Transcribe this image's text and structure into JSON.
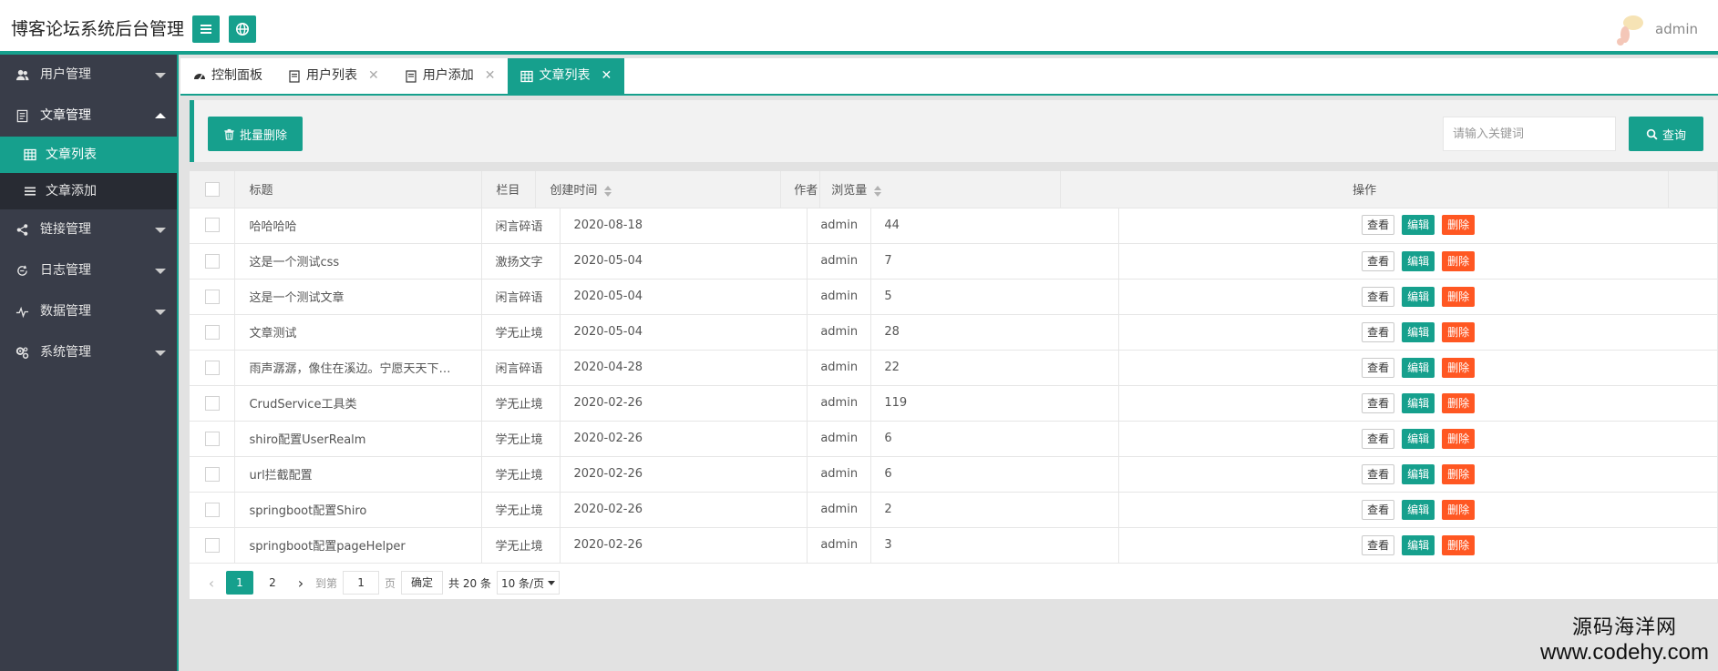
{
  "header": {
    "title": "博客论坛系统后台管理",
    "user_name": "admin"
  },
  "sidebar": {
    "items": [
      {
        "label": "用户管理",
        "icon": "users-icon"
      },
      {
        "label": "文章管理",
        "icon": "document-icon",
        "open": true
      },
      {
        "label": "链接管理",
        "icon": "share-icon"
      },
      {
        "label": "日志管理",
        "icon": "log-icon"
      },
      {
        "label": "数据管理",
        "icon": "pulse-icon"
      },
      {
        "label": "系统管理",
        "icon": "gears-icon"
      }
    ],
    "submenu": [
      {
        "label": "文章列表",
        "icon": "table-icon",
        "active": true
      },
      {
        "label": "文章添加",
        "icon": "list-icon"
      }
    ]
  },
  "tabs": [
    {
      "label": "控制面板",
      "icon": "dashboard-icon",
      "closable": false
    },
    {
      "label": "用户列表",
      "icon": "file-icon",
      "closable": true
    },
    {
      "label": "用户添加",
      "icon": "file-icon",
      "closable": true
    },
    {
      "label": "文章列表",
      "icon": "table-icon",
      "closable": true,
      "active": true
    }
  ],
  "toolbar": {
    "batch_delete": "批量删除",
    "search_placeholder": "请输入关键词",
    "query": "查询"
  },
  "table": {
    "columns": [
      "标题",
      "栏目",
      "创建时间",
      "作者",
      "浏览量",
      "操作"
    ],
    "actions": {
      "view": "查看",
      "edit": "编辑",
      "delete": "删除"
    },
    "rows": [
      {
        "title": "哈哈哈哈",
        "column": "闲言碎语",
        "created": "2020-08-18",
        "author": "admin",
        "views": "44"
      },
      {
        "title": "这是一个测试css",
        "column": "激扬文字",
        "created": "2020-05-04",
        "author": "admin",
        "views": "7"
      },
      {
        "title": "这是一个测试文章",
        "column": "闲言碎语",
        "created": "2020-05-04",
        "author": "admin",
        "views": "5"
      },
      {
        "title": "文章测试",
        "column": "学无止境",
        "created": "2020-05-04",
        "author": "admin",
        "views": "28"
      },
      {
        "title": "雨声潺潺，像住在溪边。宁愿天天下…",
        "column": "闲言碎语",
        "created": "2020-04-28",
        "author": "admin",
        "views": "22"
      },
      {
        "title": "CrudService工具类",
        "column": "学无止境",
        "created": "2020-02-26",
        "author": "admin",
        "views": "119"
      },
      {
        "title": "shiro配置UserRealm",
        "column": "学无止境",
        "created": "2020-02-26",
        "author": "admin",
        "views": "6"
      },
      {
        "title": "url拦截配置",
        "column": "学无止境",
        "created": "2020-02-26",
        "author": "admin",
        "views": "6"
      },
      {
        "title": "springboot配置Shiro",
        "column": "学无止境",
        "created": "2020-02-26",
        "author": "admin",
        "views": "2"
      },
      {
        "title": "springboot配置pageHelper",
        "column": "学无止境",
        "created": "2020-02-26",
        "author": "admin",
        "views": "3"
      }
    ]
  },
  "pager": {
    "pages": [
      "1",
      "2"
    ],
    "current": "1",
    "goto_label": "到第",
    "goto_value": "1",
    "page_unit": "页",
    "confirm": "确定",
    "total": "共 20 条",
    "page_size": "10 条/页"
  },
  "watermark": {
    "line1": "源码海洋网",
    "line2": "www.codehy.com"
  },
  "colors": {
    "accent": "#16a08d",
    "danger": "#ff5722",
    "sidebar": "#393d49"
  }
}
